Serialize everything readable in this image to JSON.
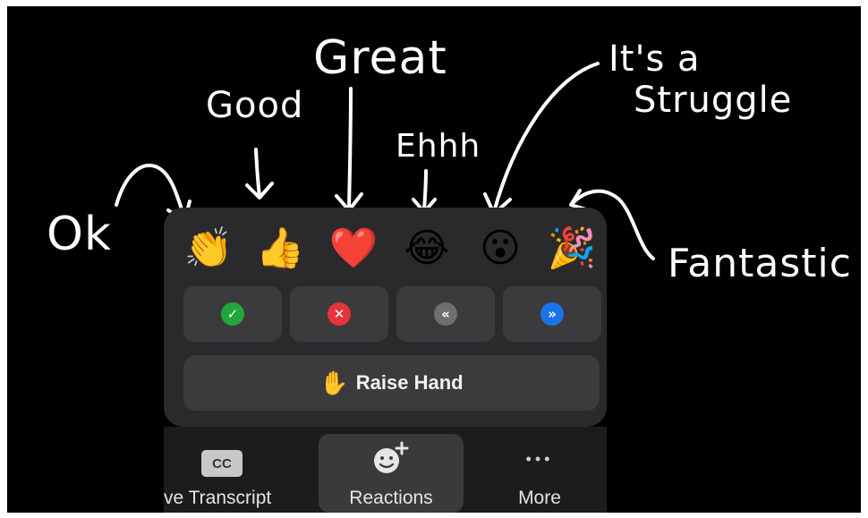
{
  "annotations": {
    "ok": "Ok",
    "good": "Good",
    "great": "Great",
    "ehhh": "Ehhh",
    "struggle_line1": "It's a",
    "struggle_line2": "Struggle",
    "fantastic": "Fantastic"
  },
  "reactions": {
    "emojis": [
      "👏",
      "👍",
      "❤️",
      "😂",
      "😮",
      "🎉"
    ],
    "emoji_names": [
      "clapping-hands-icon",
      "thumbs-up-icon",
      "heart-icon",
      "tears-of-joy-icon",
      "surprised-face-icon",
      "party-popper-icon"
    ],
    "nonverbal": [
      {
        "symbol": "✓",
        "color": "#22a83a",
        "icon": "yes-check-icon"
      },
      {
        "symbol": "✕",
        "color": "#e5343a",
        "icon": "no-x-icon"
      },
      {
        "symbol": "«",
        "color": "#6f6f72",
        "icon": "slower-icon"
      },
      {
        "symbol": "»",
        "color": "#1a73e8",
        "icon": "faster-icon"
      }
    ],
    "raise_hand_emoji": "✋",
    "raise_hand_label": "Raise Hand"
  },
  "toolbar": {
    "cc_badge": "CC",
    "transcript_label": "ve Transcript",
    "reactions_label": "Reactions",
    "more_label": "More",
    "more_dots": "•••"
  },
  "colors": {
    "background": "#000000",
    "popup": "#2a2a2c",
    "button": "#3b3b3e",
    "annotation": "#ffffff"
  }
}
